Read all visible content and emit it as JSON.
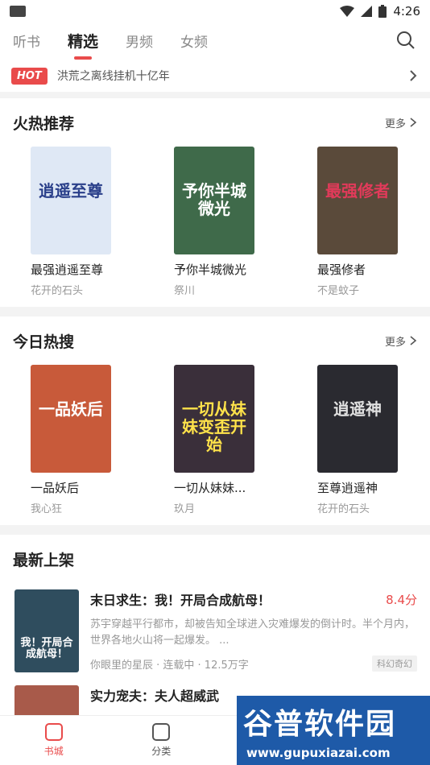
{
  "status": {
    "time": "4:26",
    "left_icon": "app-icon"
  },
  "tabs": [
    "听书",
    "精选",
    "男频",
    "女频"
  ],
  "active_tab": 1,
  "hot": {
    "badge": "HOT",
    "text": "洪荒之离线挂机十亿年"
  },
  "sections": {
    "hot_rec": {
      "title": "火热推荐",
      "more": "更多",
      "books": [
        {
          "name": "最强逍遥至尊",
          "author": "花开的石头",
          "cover_title": "逍遥至尊",
          "cover_bg": "#dfe8f5",
          "cover_fg": "#2a3f8a"
        },
        {
          "name": "予你半城微光",
          "author": "祭川",
          "cover_title": "予你半城微光",
          "cover_bg": "#3f6a4a",
          "cover_fg": "#ffffff"
        },
        {
          "name": "最强修者",
          "author": "不是蚊子",
          "cover_title": "最强修者",
          "cover_bg": "#5a4a3a",
          "cover_fg": "#e23a5a"
        }
      ]
    },
    "today_hot": {
      "title": "今日热搜",
      "more": "更多",
      "books": [
        {
          "name": "一品妖后",
          "author": "我心狂",
          "cover_title": "一品妖后",
          "cover_bg": "#c85a3a",
          "cover_fg": "#ffffff"
        },
        {
          "name": "一切从妹妹...",
          "author": "玖月",
          "cover_title": "一切从妹妹变歪开始",
          "cover_bg": "#3a2f3a",
          "cover_fg": "#ffe24a"
        },
        {
          "name": "至尊逍遥神",
          "author": "花开的石头",
          "cover_title": "逍遥神",
          "cover_bg": "#2a2a30",
          "cover_fg": "#e0e0e0"
        }
      ]
    },
    "new_books": {
      "title": "最新上架",
      "items": [
        {
          "title": "末日求生：我！开局合成航母！",
          "score": "8.4分",
          "desc": "苏宇穿越平行都市，却被告知全球进入灾难爆发的倒计时。半个月内，世界各地火山将一起爆发。 ...",
          "meta": "你眼里的星辰 · 连载中 · 12.5万字",
          "tag": "科幻奇幻",
          "cover_title": "我！开局合成航母！",
          "cover_bg": "#2f4d5e"
        },
        {
          "title": "实力宠夫：夫人超威武",
          "cover_bg": "#a85a4a"
        }
      ]
    }
  },
  "nav": [
    {
      "label": "书城",
      "icon": "bookstore-icon"
    },
    {
      "label": "分类",
      "icon": "category-icon"
    }
  ],
  "watermark": {
    "main": "谷普软件园",
    "url": "www.gupuxiazai.com"
  },
  "colors": {
    "accent": "#e94b4b",
    "hot_badge": "#e94b4b"
  }
}
